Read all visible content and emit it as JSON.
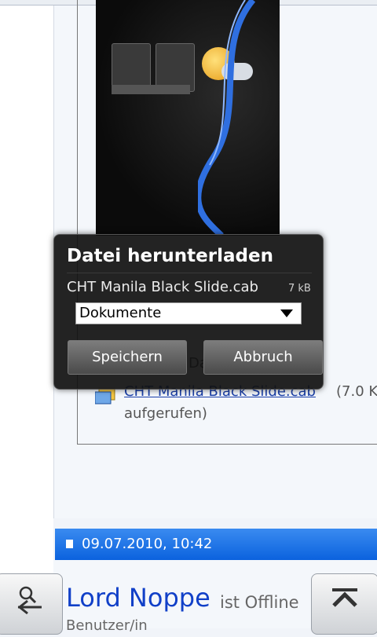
{
  "dialog": {
    "title": "Datei herunterladen",
    "filename": "CHT Manila Black Slide.cab",
    "filesize": "7 kB",
    "folder": "Dokumente",
    "save_label": "Speichern",
    "cancel_label": "Abbruch"
  },
  "post": {
    "date_fragment": "Da",
    "attachment": {
      "name": "CHT Manila Black Slide.cab",
      "size": "(7.0 K",
      "viewed": "aufgerufen)"
    },
    "header_date": "09.07.2010, 10:42",
    "author_name": "Lord Noppe",
    "author_status": "ist Offline",
    "author_role": "Benutzer/in"
  },
  "colors": {
    "header_blue": "#0b62de",
    "link_blue": "#1a3fa8",
    "author_blue": "#1140c8"
  },
  "icons": {
    "zoom_back": "zoom-out-back-icon",
    "scroll_top": "scroll-to-top-icon",
    "attachment": "cab-file-icon",
    "dropdown": "chevron-down-icon"
  }
}
